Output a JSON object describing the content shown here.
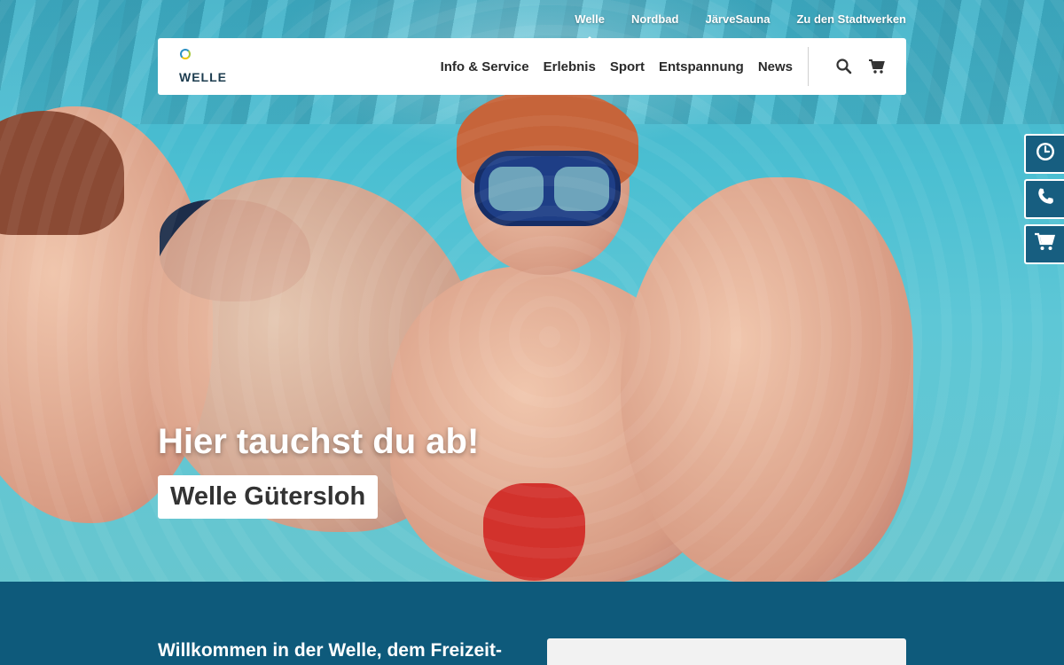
{
  "topnav": {
    "items": [
      {
        "label": "Welle",
        "active": true
      },
      {
        "label": "Nordbad"
      },
      {
        "label": "JärveSauna"
      },
      {
        "label": "Zu den Stadtwerken"
      }
    ]
  },
  "header": {
    "logo_text": "WELLE",
    "nav": [
      {
        "label": "Info & Service"
      },
      {
        "label": "Erlebnis"
      },
      {
        "label": "Sport"
      },
      {
        "label": "Entspannung"
      },
      {
        "label": "News"
      }
    ],
    "icons": [
      "search-icon",
      "cart-icon"
    ]
  },
  "hero": {
    "title": "Hier tauchst du ab!",
    "subtitle": "Welle Gütersloh"
  },
  "side_buttons": [
    "clock-icon",
    "phone-icon",
    "cart-icon"
  ],
  "section": {
    "welcome": "Willkommen in der Welle, dem Freizeit-"
  },
  "colors": {
    "brand_blue": "#0e5a7b",
    "side_button": "#175e80",
    "header_bg": "#ffffff"
  }
}
